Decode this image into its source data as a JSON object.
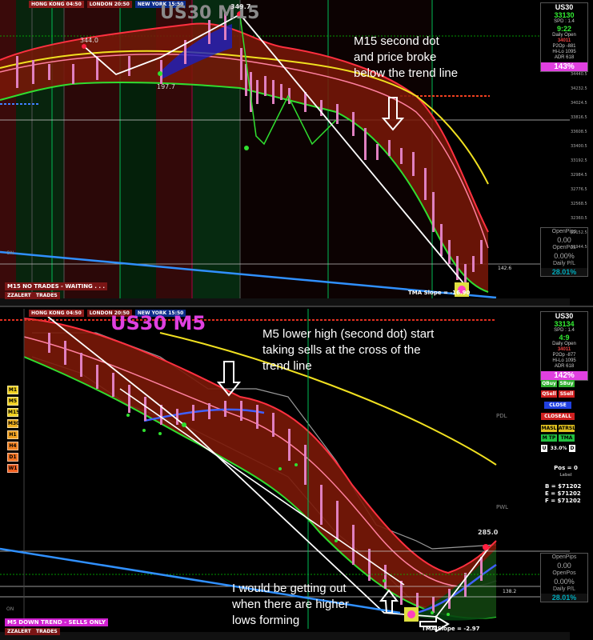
{
  "sessions": {
    "hong_kong": "HONG KONG 04:50",
    "london": "LONDON 20:50",
    "new_york": "NEW YORK 15:50"
  },
  "m15": {
    "title": "US30 M15",
    "annotation": [
      "M15 second dot",
      "and price broke",
      "below the trend line"
    ],
    "peak_label": "349.7",
    "left_label": "344.0",
    "low_label": "197.7",
    "status": "M15  NO TRADES - WAITING . . .",
    "zzalert": "ZZALERT",
    "trades": "TRADES",
    "tma_slope": "TMA Slope = -16.90",
    "level_label": "142.6",
    "on": "ON",
    "info": {
      "symbol": "US30",
      "price": "33130",
      "spd": "SPD : 1.4",
      "time": "9:22",
      "daily_open_label": "Daily Open",
      "daily_open": "34011",
      "p2p": "P2Op  -881",
      "hilo": "Hi-Lo  1095",
      "adr": "ADR   618",
      "pct": "143%"
    },
    "pips": {
      "open_pips": "OpenPips",
      "open_pips_val": "0.00",
      "open_pos": "OpenPos",
      "open_pos_val": "0.00%",
      "daily_pl": "Daily P/L",
      "daily_pl_val": "28.01%"
    },
    "axis": [
      "34440.5",
      "34232.5",
      "34024.5",
      "33816.5",
      "33608.5",
      "33400.5",
      "33192.5",
      "32984.5",
      "32776.5",
      "32568.5",
      "32360.5",
      "32152.5",
      "31944.5"
    ]
  },
  "m5": {
    "title": "US30 M5",
    "annotation": [
      "M5 lower high (second dot) start",
      "taking sells at the cross of the",
      "trend line"
    ],
    "annotation2": [
      "I would be getting out",
      "when there are higher",
      "lows forming"
    ],
    "peak_label": "285.0",
    "status": "M5  DOWN TREND - SELLS ONLY",
    "zzalert": "ZZALERT",
    "trades": "TRADES",
    "tma_slope": "TMA Slope = -2.97",
    "level_label": "138.2",
    "pdl": "PDL",
    "pwl": "PWL",
    "on": "ON",
    "timeframes": [
      "M1",
      "M5",
      "M15",
      "M30",
      "H1",
      "H4",
      "D1",
      "W1"
    ],
    "tf_colors": [
      "#f0d020",
      "#f0d020",
      "#f0d020",
      "#f0b020",
      "#f0a020",
      "#f08020",
      "#f07020",
      "#f06020"
    ],
    "info": {
      "symbol": "US30",
      "price": "33134",
      "spd": "SPD : 1.4",
      "time": "4:9",
      "daily_open_label": "Daily Open",
      "daily_open": "34011",
      "p2p": "P2Op  -877",
      "hilo": "Hi-Lo  1095",
      "adr": "ADR   618",
      "pct": "142%"
    },
    "trade_buttons": {
      "qbuy": "QBuy",
      "sbuy": "SBuy",
      "qsell": "QSell",
      "ssell": "SSell",
      "close": "CLOSE",
      "closeall": "CLOSEALL",
      "masl": "MASL",
      "atrsl": "ATRSL",
      "mtp": "M TP",
      "tmatp": "TMA TP",
      "u": "U",
      "u_pct": "33.0%",
      "d": "D"
    },
    "pos": {
      "label": "Pos = 0",
      "sublabel": "Label"
    },
    "be": {
      "b": "B = $71202",
      "e": "E = $71202",
      "f": "F = $71202"
    },
    "pips": {
      "open_pips": "OpenPips",
      "open_pips_val": "0.00",
      "open_pos": "OpenPos",
      "open_pos_val": "0.00%",
      "daily_pl": "Daily P/L",
      "daily_pl_val": "28.01%"
    }
  }
}
